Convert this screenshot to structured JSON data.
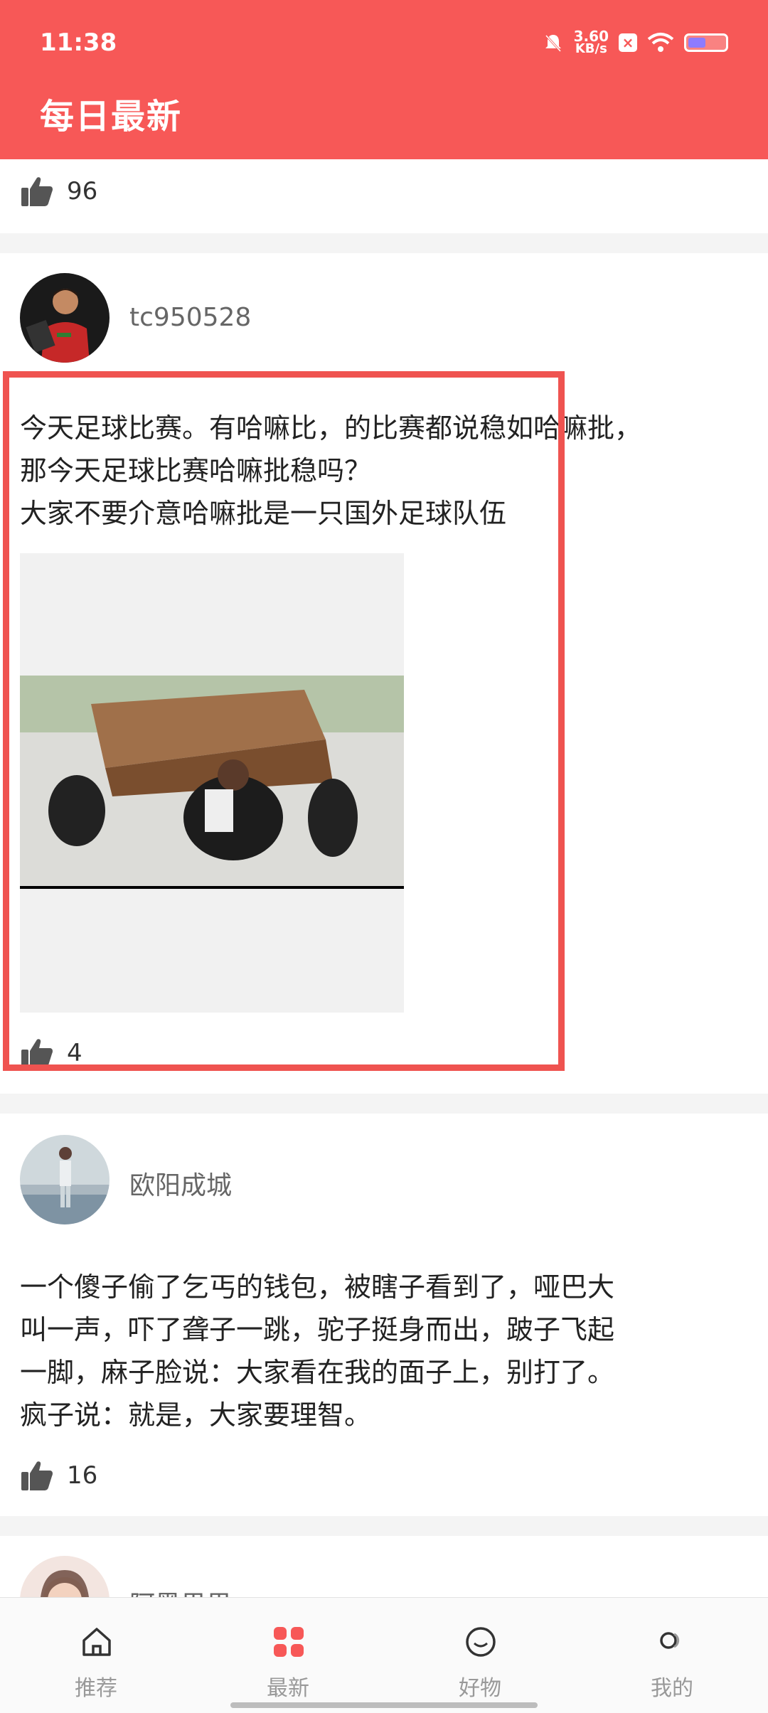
{
  "status_bar": {
    "time": "11:38",
    "speed_value": "3.60",
    "speed_unit": "KB/s"
  },
  "header": {
    "title": "每日最新"
  },
  "colors": {
    "accent": "#f75857",
    "highlight_border": "#ef5350"
  },
  "posts": [
    {
      "likes": "96"
    },
    {
      "username": "tc950528",
      "text_lines": [
        "今天足球比赛。有哈嘛比，的比赛都说稳如哈嘛批，",
        "那今天足球比赛哈嘛批稳吗？",
        "大家不要介意哈嘛批是一只国外足球队伍"
      ],
      "likes": "4"
    },
    {
      "username": "欧阳成城",
      "text_lines": [
        "一个傻子偷了乞丐的钱包，被瞎子看到了，哑巴大",
        "叫一声，吓了聋子一跳，驼子挺身而出，跛子飞起",
        "一脚，麻子脸说：大家看在我的面子上，别打了。",
        "疯子说：就是，大家要理智。"
      ],
      "likes": "16"
    },
    {
      "username": "阿黑果果"
    }
  ],
  "bottom_nav": [
    {
      "label": "推荐",
      "icon": "home-icon"
    },
    {
      "label": "最新",
      "icon": "grid-icon",
      "active": true
    },
    {
      "label": "好物",
      "icon": "smile-icon"
    },
    {
      "label": "我的",
      "icon": "profile-toggle-icon"
    }
  ]
}
